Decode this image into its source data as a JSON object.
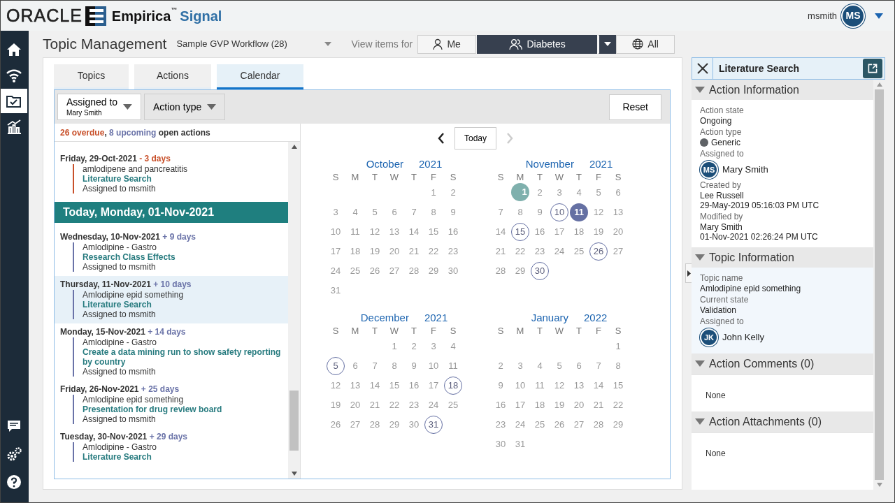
{
  "header": {
    "brand": "ORACLE",
    "product": "Empirica",
    "trademark": "™",
    "product_suffix": "Signal",
    "user": "msmith",
    "user_initials": "MS"
  },
  "sidebar": {
    "items": [
      {
        "kind": "home",
        "selected": false
      },
      {
        "kind": "signal",
        "selected": false
      },
      {
        "kind": "folder",
        "selected": true
      },
      {
        "kind": "chart",
        "selected": false
      },
      {
        "kind": "chat",
        "selected": false
      },
      {
        "kind": "gears",
        "selected": false
      },
      {
        "kind": "help",
        "selected": false
      }
    ]
  },
  "page": {
    "title": "Topic Management",
    "workflow": "Sample GVP Workflow (28)",
    "view_label": "View items for",
    "view_options": [
      {
        "label": "Me",
        "kind": "person",
        "selected": false
      },
      {
        "label": "Diabetes",
        "kind": "group",
        "selected": true
      },
      {
        "label": "All",
        "kind": "globe",
        "selected": false
      }
    ]
  },
  "tabs": [
    {
      "label": "Topics",
      "selected": false
    },
    {
      "label": "Actions",
      "selected": false
    },
    {
      "label": "Calendar",
      "selected": true
    }
  ],
  "filters": {
    "assigned_label": "Assigned to",
    "assigned_value": "Mary Smith",
    "action_type": "Action type",
    "reset": "Reset"
  },
  "summary": [
    {
      "text": "26 overdue",
      "kind": "overdue"
    },
    {
      "text": ",",
      "kind": "plain"
    },
    {
      "text": " 8 upcoming",
      "kind": "upcoming"
    },
    {
      "text": " open actions",
      "kind": "plain"
    }
  ],
  "events": [
    {
      "kind": "overdue",
      "date": "Friday, 29-Oct-2021",
      "delta": "- 3 days",
      "topic": "amlodipene and pancreatitis",
      "action": "Literature Search",
      "assignee": "Assigned to msmith",
      "selected": false
    },
    {
      "kind": "today",
      "date": "Today, Monday, 01-Nov-2021"
    },
    {
      "kind": "upcoming",
      "date": "Wednesday, 10-Nov-2021",
      "delta": "+ 9 days",
      "topic": "Amlodipine - Gastro",
      "action": "Research Class Effects",
      "assignee": "Assigned to msmith",
      "selected": false
    },
    {
      "kind": "upcoming",
      "date": "Thursday, 11-Nov-2021",
      "delta": "+ 10 days",
      "topic": "Amlodipine epid something",
      "action": "Literature Search",
      "assignee": "Assigned to msmith",
      "selected": true
    },
    {
      "kind": "upcoming",
      "date": "Monday, 15-Nov-2021",
      "delta": "+ 14 days",
      "topic": "Amlodipine - Gastro",
      "action": "Create a data mining run to show safety reporting by country",
      "assignee": "Assigned to msmith",
      "selected": false
    },
    {
      "kind": "upcoming",
      "date": "Friday, 26-Nov-2021",
      "delta": "+ 25 days",
      "topic": "Amlodipine epid something",
      "action": "Presentation for drug review board",
      "assignee": "Assigned to msmith",
      "selected": false
    },
    {
      "kind": "upcoming",
      "date": "Tuesday, 30-Nov-2021",
      "delta": "+ 29 days",
      "topic": "Amlodipine - Gastro",
      "action": "Literature Search",
      "selected": false
    }
  ],
  "calendar": {
    "today_button": "Today",
    "prev_enabled": true,
    "next_enabled": false,
    "months": [
      {
        "month": "October",
        "year": "2021",
        "weekdays": [
          "S",
          "M",
          "T",
          "W",
          "T",
          "F",
          "S"
        ],
        "weeks": [
          [
            "1",
            "2"
          ],
          [
            "3",
            "4",
            "5",
            "6",
            "7",
            "8",
            "9"
          ],
          [
            "10",
            "11",
            "12",
            "13",
            "14",
            "15",
            "16"
          ],
          [
            "17",
            "18",
            "19",
            "20",
            "21",
            "22",
            "23"
          ],
          [
            "24",
            "25",
            "26",
            "27",
            "28",
            "29",
            "30"
          ],
          [
            "31"
          ]
        ]
      },
      {
        "month": "November",
        "year": "2021",
        "weekdays": [
          "S",
          "M",
          "T",
          "W",
          "T",
          "F",
          "S"
        ],
        "weeks": [
          [
            {
              "day": "1",
              "kind": "today"
            },
            "2",
            "3",
            "4",
            "5",
            "6"
          ],
          [
            "7",
            "8",
            "9",
            {
              "day": "10",
              "kind": "event"
            },
            {
              "day": "11",
              "kind": "selected"
            },
            "12",
            "13"
          ],
          [
            "14",
            {
              "day": "15",
              "kind": "event"
            },
            "16",
            "17",
            "18",
            "19",
            "20"
          ],
          [
            "21",
            "22",
            "23",
            "24",
            "25",
            {
              "day": "26",
              "kind": "event"
            },
            "27"
          ],
          [
            "28",
            "29",
            {
              "day": "30",
              "kind": "event"
            }
          ]
        ]
      },
      {
        "month": "December",
        "year": "2021",
        "weekdays": [
          "S",
          "M",
          "T",
          "W",
          "T",
          "F",
          "S"
        ],
        "weeks": [
          [
            "1",
            "2",
            "3",
            "4"
          ],
          [
            {
              "day": "5",
              "kind": "event"
            },
            "6",
            "7",
            "8",
            "9",
            "10",
            "11"
          ],
          [
            "12",
            "13",
            "14",
            "15",
            "16",
            "17",
            {
              "day": "18",
              "kind": "event"
            }
          ],
          [
            "19",
            "20",
            "21",
            "22",
            "23",
            "24",
            "25"
          ],
          [
            "26",
            "27",
            "28",
            "29",
            "30",
            {
              "day": "31",
              "kind": "event"
            }
          ]
        ]
      },
      {
        "month": "January",
        "year": "2022",
        "weekdays": [
          "S",
          "M",
          "T",
          "W",
          "T",
          "F",
          "S"
        ],
        "weeks": [
          [
            "1"
          ],
          [
            "2",
            "3",
            "4",
            "5",
            "6",
            "7",
            "8"
          ],
          [
            "9",
            "10",
            "11",
            "12",
            "13",
            "14",
            "15"
          ],
          [
            "16",
            "17",
            "18",
            "19",
            "20",
            "21",
            "22"
          ],
          [
            "23",
            "24",
            "25",
            "26",
            "27",
            "28",
            "29"
          ],
          [
            "30",
            "31"
          ]
        ]
      }
    ]
  },
  "detail": {
    "title": "Literature Search",
    "sections": [
      {
        "title": "Action Information",
        "expanded": true,
        "tinted": false,
        "fields": [
          {
            "label": "Action state",
            "kind": "text",
            "lines": [
              "Ongoing"
            ]
          },
          {
            "label": "Action type",
            "kind": "dot",
            "color": "#5f6266",
            "lines": [
              "Generic"
            ]
          },
          {
            "label": "Assigned to",
            "kind": "avatar",
            "initials": "MS",
            "lines": [
              "Mary Smith"
            ]
          },
          {
            "label": "Created by",
            "kind": "text",
            "lines": [
              "Lee Russell",
              "29-May-2019 05:16:03 PM UTC"
            ]
          },
          {
            "label": "Modified by",
            "kind": "text",
            "lines": [
              "Mary Smith",
              "01-Nov-2021 02:26:24 PM UTC"
            ]
          }
        ]
      },
      {
        "title": "Topic Information",
        "expanded": true,
        "tinted": true,
        "fields": [
          {
            "label": "Topic name",
            "kind": "text",
            "lines": [
              "Amlodipine epid something"
            ]
          },
          {
            "label": "Current state",
            "kind": "text",
            "lines": [
              "Validation"
            ]
          },
          {
            "label": "Assigned to",
            "kind": "avatar",
            "initials": "JK",
            "lines": [
              "John Kelly"
            ]
          }
        ]
      },
      {
        "title": "Action Comments (0)",
        "expanded": true,
        "tinted": false,
        "empty": "None"
      },
      {
        "title": "Action Attachments (0)",
        "expanded": true,
        "tinted": false,
        "empty": "None"
      }
    ]
  }
}
